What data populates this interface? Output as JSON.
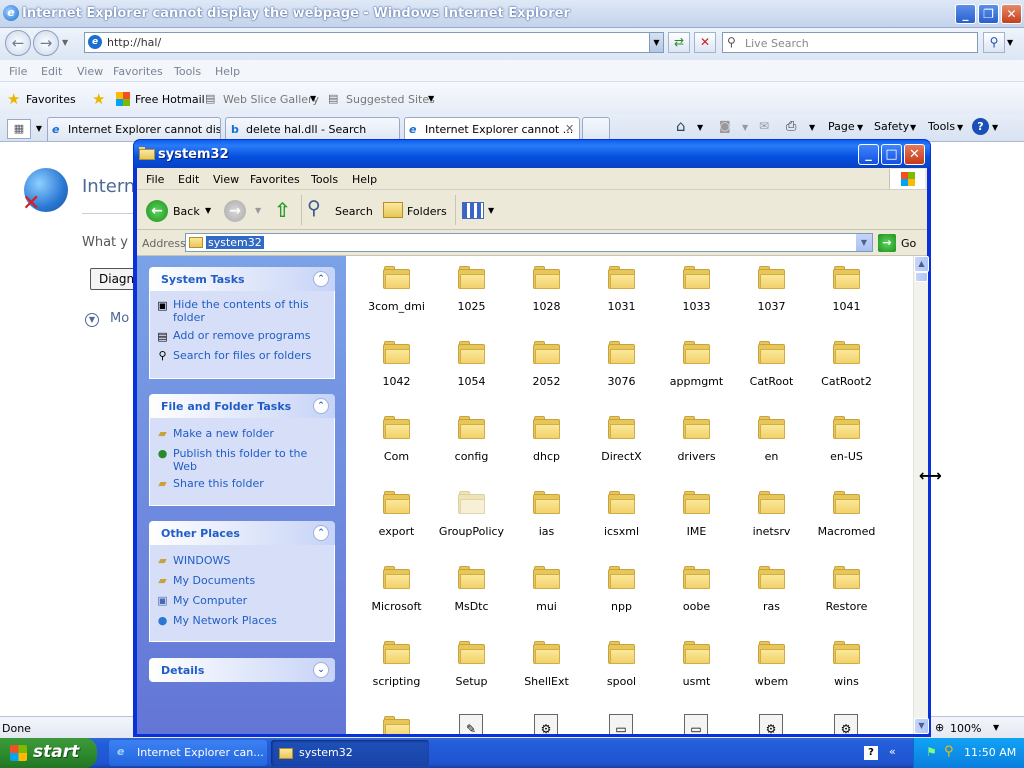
{
  "ie": {
    "title": "Internet Explorer cannot display the webpage - Windows Internet Explorer",
    "url": "http://hal/",
    "search_placeholder": "Live Search",
    "menu": [
      "File",
      "Edit",
      "View",
      "Favorites",
      "Tools",
      "Help"
    ],
    "favorites_label": "Favorites",
    "fav_links": [
      "Free Hotmail",
      "Web Slice Gallery",
      "Suggested Sites"
    ],
    "tabs": [
      "Internet Explorer cannot dis...",
      "delete hal.dll - Search",
      "Internet Explorer cannot ..."
    ],
    "cmd_bar": [
      "Page",
      "Safety",
      "Tools"
    ],
    "page_heading_partial": "Intern",
    "page_line_partial": "What y",
    "page_button_partial": "Diagn",
    "page_more_partial": "Mo",
    "status_text": "Done",
    "zoom": "100%"
  },
  "explorer": {
    "title": "system32",
    "menu": [
      "File",
      "Edit",
      "View",
      "Favorites",
      "Tools",
      "Help"
    ],
    "toolbar": {
      "back": "Back",
      "search": "Search",
      "folders": "Folders"
    },
    "address_label": "Address",
    "address_value": "system32",
    "go_label": "Go",
    "system_tasks": {
      "title": "System Tasks",
      "items": [
        "Hide the contents of this folder",
        "Add or remove programs",
        "Search for files or folders"
      ]
    },
    "file_tasks": {
      "title": "File and Folder Tasks",
      "items": [
        "Make a new folder",
        "Publish this folder to the Web",
        "Share this folder"
      ]
    },
    "other_places": {
      "title": "Other Places",
      "items": [
        "WINDOWS",
        "My Documents",
        "My Computer",
        "My Network Places"
      ]
    },
    "details_title": "Details",
    "folders": [
      "3com_dmi",
      "1025",
      "1028",
      "1031",
      "1033",
      "1037",
      "1041",
      "1042",
      "1054",
      "2052",
      "3076",
      "appmgmt",
      "CatRoot",
      "CatRoot2",
      "Com",
      "config",
      "dhcp",
      "DirectX",
      "drivers",
      "en",
      "en-US",
      "export",
      "GroupPolicy",
      "ias",
      "icsxml",
      "IME",
      "inetsrv",
      "Macromed",
      "Microsoft",
      "MsDtc",
      "mui",
      "npp",
      "oobe",
      "ras",
      "Restore",
      "scripting",
      "Setup",
      "ShellExt",
      "spool",
      "usmt",
      "wbem",
      "wins"
    ]
  },
  "taskbar": {
    "start_label": "start",
    "tasks": [
      "Internet Explorer can...",
      "system32"
    ],
    "clock": "11:50 AM"
  },
  "colors": {
    "xp_blue": "#0831d9",
    "task_link": "#215dc6",
    "start_green": "#2e8b2e"
  }
}
